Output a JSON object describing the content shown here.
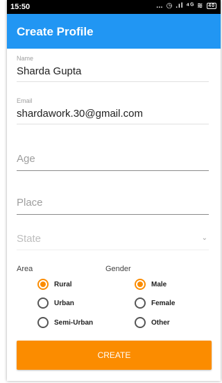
{
  "status_bar": {
    "time": "15:50",
    "icons_text": "… ◷ .ıl ⁴ᴳ ≋",
    "battery": "40"
  },
  "app_bar": {
    "title": "Create Profile"
  },
  "form": {
    "name": {
      "label": "Name",
      "value": "Sharda Gupta"
    },
    "email": {
      "label": "Email",
      "value": "shardawork.30@gmail.com"
    },
    "age": {
      "placeholder": "Age"
    },
    "place": {
      "placeholder": "Place"
    },
    "state": {
      "placeholder": "State",
      "arrow": "⌄"
    },
    "area": {
      "label": "Area",
      "options": [
        {
          "label": "Rural",
          "checked": true
        },
        {
          "label": "Urban",
          "checked": false
        },
        {
          "label": "Semi-Urban",
          "checked": false
        }
      ]
    },
    "gender": {
      "label": "Gender",
      "options": [
        {
          "label": "Male",
          "checked": true
        },
        {
          "label": "Female",
          "checked": false
        },
        {
          "label": "Other",
          "checked": false
        }
      ]
    },
    "submit_label": "CREATE"
  },
  "colors": {
    "app_bar": "#2196f3",
    "accent": "#fb8c00",
    "status_bar": "#000000"
  }
}
